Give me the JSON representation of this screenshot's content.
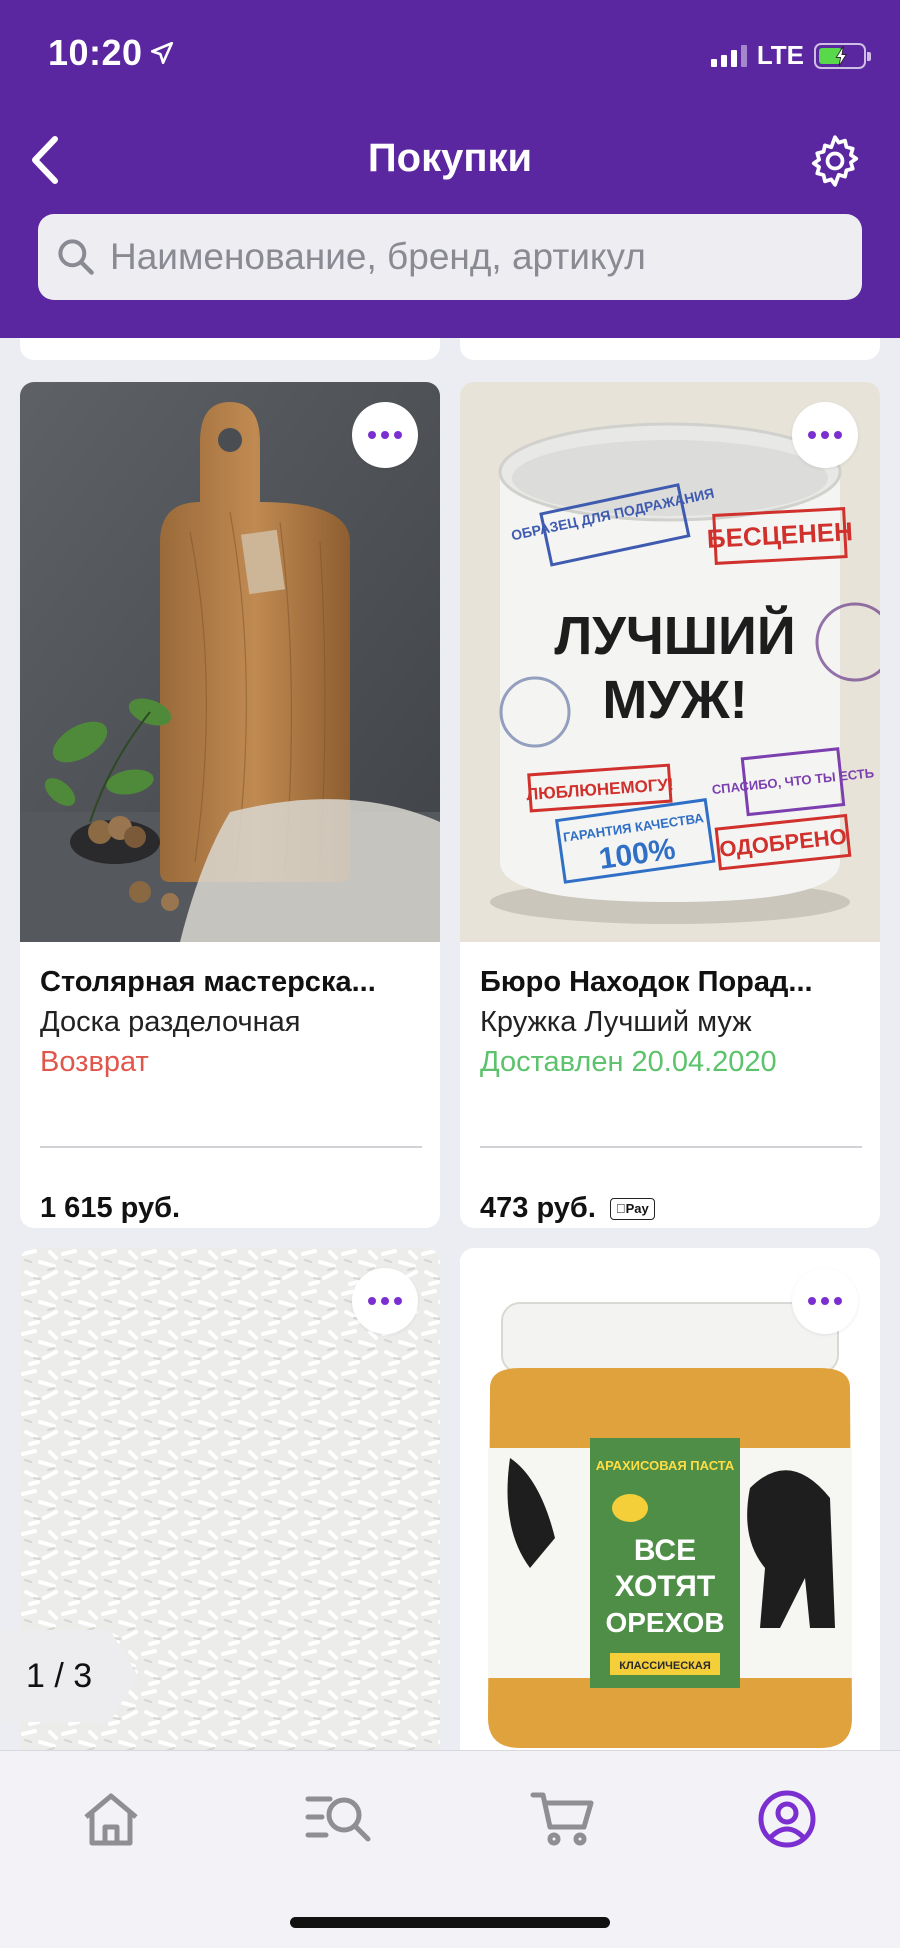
{
  "status_bar": {
    "time": "10:20",
    "network": "LTE"
  },
  "header": {
    "title": "Покупки",
    "search_placeholder": "Наименование, бренд, артикул"
  },
  "products": [
    {
      "seller": "Столярная мастерска...",
      "name": "Доска разделочная",
      "status": "Возврат",
      "status_color": "#e0564a",
      "price": "1 615 руб.",
      "apple_pay": false,
      "image": "wooden-cutting-board-photo"
    },
    {
      "seller": "Бюро Находок Порад...",
      "name": "Кружка Лучший муж",
      "status": "Доставлен 20.04.2020",
      "status_color": "#5cc26b",
      "price": "473 руб.",
      "apple_pay": true,
      "apple_pay_label": "Pay",
      "image": "mug-photo",
      "mug_text": {
        "main_line1": "ЛУЧШИЙ",
        "main_line2": "МУЖ!",
        "stamp_sample": "ОБРАЗЕЦ ДЛЯ ПОДРАЖАНИЯ",
        "stamp_priceless": "БЕСЦЕНЕН",
        "stamp_beloved": "ЛЮБЛЮНЕМОГУ!",
        "stamp_thanks": "СПАСИБО, ЧТО ТЫ ЕСТЬ",
        "stamp_guarantee": "ГАРАНТИЯ КАЧЕСТВА",
        "stamp_percent": "100%",
        "stamp_approved": "ОДОБРЕНО"
      }
    },
    {
      "image": "coconut-flakes-photo"
    },
    {
      "image": "peanut-butter-jar-photo",
      "jar_text": {
        "top": "АРАХИСОВАЯ ПАСТА",
        "main1": "ВСЕ",
        "main2": "ХОТЯТ",
        "main3": "ОРЕХОВ",
        "bottom": "КЛАССИЧЕСКАЯ"
      }
    }
  ],
  "pager": {
    "label": "1 / 3"
  },
  "tab_bar": {
    "items": [
      "home-icon",
      "catalog-search-icon",
      "cart-icon",
      "profile-icon"
    ],
    "active_index": 3,
    "active_color": "#7b2fd0",
    "inactive_color": "#8e8e93"
  },
  "colors": {
    "brand": "#5a27a0",
    "accent": "#7b2fd0"
  }
}
